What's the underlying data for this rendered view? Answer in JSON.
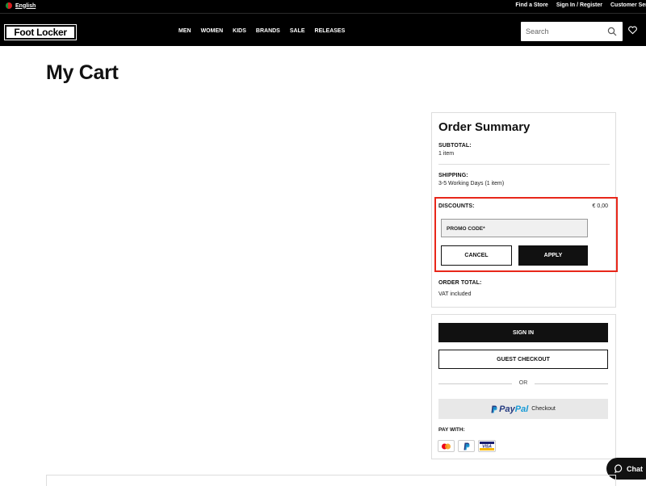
{
  "topbar": {
    "language": "English",
    "links": [
      "Find a Store",
      "Sign In / Register",
      "Customer Service"
    ]
  },
  "header": {
    "logo": "Foot Locker",
    "nav": [
      "MEN",
      "WOMEN",
      "KIDS",
      "BRANDS",
      "SALE",
      "RELEASES"
    ],
    "search_placeholder": "Search"
  },
  "page": {
    "title": "My Cart"
  },
  "order_summary": {
    "title": "Order Summary",
    "subtotal_label": "SUBTOTAL:",
    "subtotal_items": "1 item",
    "shipping_label": "SHIPPING:",
    "shipping_detail": "3-5 Working Days (1 item)",
    "discounts_label": "DISCOUNTS:",
    "discounts_value": "€ 0,00",
    "promo_placeholder": "PROMO CODE*",
    "cancel_label": "CANCEL",
    "apply_label": "APPLY",
    "total_label": "ORDER TOTAL:",
    "vat_note": "VAT included"
  },
  "checkout": {
    "signin_label": "SIGN IN",
    "guest_label": "GUEST CHECKOUT",
    "or_label": "OR",
    "paypal_word_1": "Pay",
    "paypal_word_2": "Pal",
    "paypal_checkout": "Checkout",
    "pay_with_label": "PAY WITH:",
    "payment_methods": [
      "mastercard-icon",
      "paypal-icon",
      "visa-icon"
    ]
  },
  "chat": {
    "label": "Chat"
  },
  "colors": {
    "highlight": "#e8271a",
    "brand_black": "#111111",
    "paypal_dark": "#253b80",
    "paypal_light": "#179bd7"
  }
}
